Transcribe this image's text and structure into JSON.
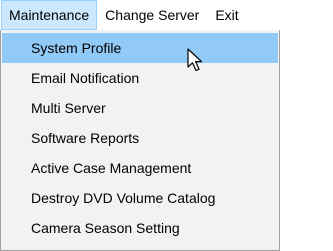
{
  "menubar": {
    "items": [
      {
        "label": "Maintenance"
      },
      {
        "label": "Change Server"
      },
      {
        "label": "Exit"
      }
    ]
  },
  "dropdown": {
    "items": [
      {
        "label": "System Profile"
      },
      {
        "label": "Email Notification"
      },
      {
        "label": "Multi Server"
      },
      {
        "label": "Software Reports"
      },
      {
        "label": "Active Case Management"
      },
      {
        "label": "Destroy DVD Volume Catalog"
      },
      {
        "label": "Camera Season Setting"
      }
    ]
  },
  "cursor": {
    "icon": "arrow-cursor-icon"
  }
}
